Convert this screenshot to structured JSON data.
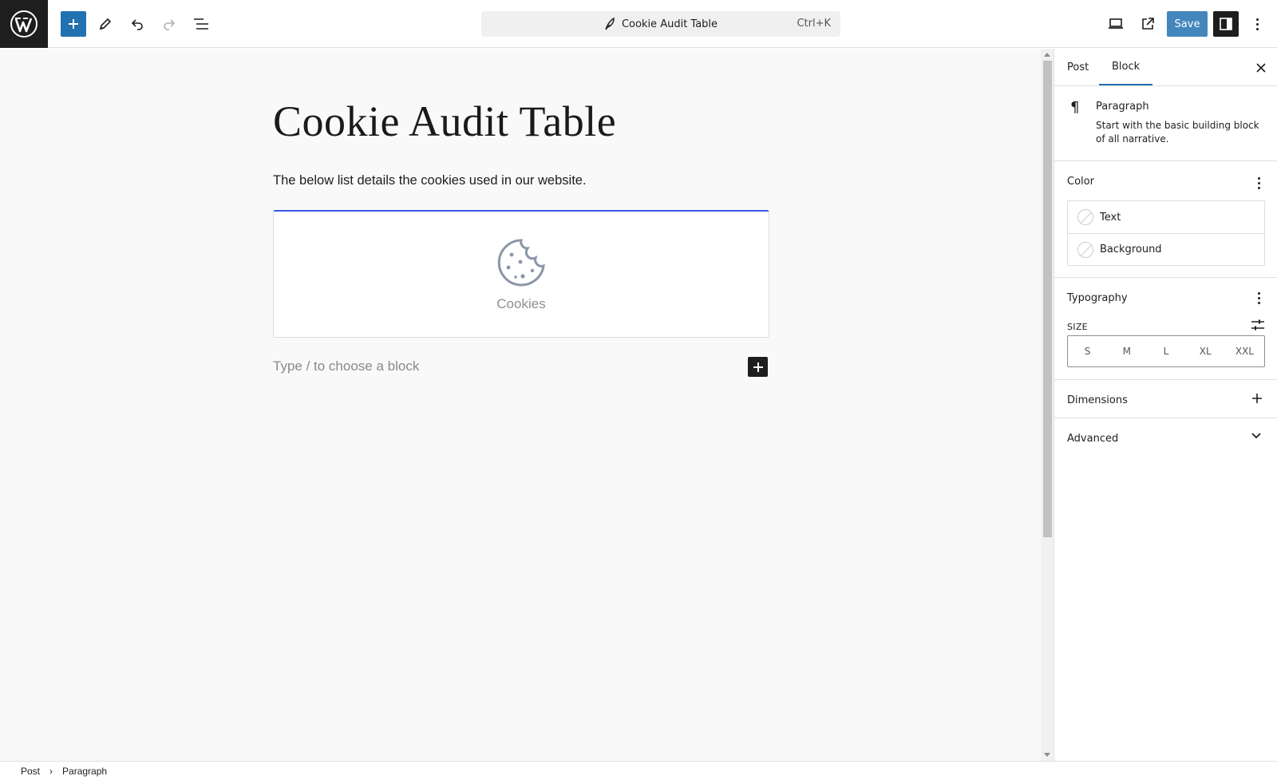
{
  "toolbar": {
    "document_title": "Cookie Audit Table",
    "shortcut": "Ctrl+K",
    "save_label": "Save",
    "icons": [
      "wordpress-logo",
      "plus-icon",
      "pencil-icon",
      "undo-icon",
      "redo-icon",
      "list-view-icon",
      "desktop-preview-icon",
      "external-link-icon",
      "sidebar-toggle-icon",
      "more-options-icon"
    ],
    "accent": "#2271b1"
  },
  "canvas": {
    "post_title": "Cookie Audit Table",
    "paragraph": "The below list details the cookies used in our website.",
    "cookie_block_label": "Cookies",
    "block_placeholder": "Type / to choose a block",
    "selected_block_border": "#3858e9"
  },
  "sidebar": {
    "tabs": [
      {
        "label": "Post",
        "active": false
      },
      {
        "label": "Block",
        "active": true
      }
    ],
    "block_card": {
      "name": "Paragraph",
      "description": "Start with the basic building block of all narrative."
    },
    "color": {
      "title": "Color",
      "items": [
        "Text",
        "Background"
      ]
    },
    "typography": {
      "title": "Typography",
      "size_label": "SIZE",
      "sizes": [
        "S",
        "M",
        "L",
        "XL",
        "XXL"
      ]
    },
    "dimensions": {
      "title": "Dimensions"
    },
    "advanced": {
      "title": "Advanced"
    }
  },
  "footer": {
    "breadcrumbs": [
      "Post",
      "Paragraph"
    ]
  }
}
